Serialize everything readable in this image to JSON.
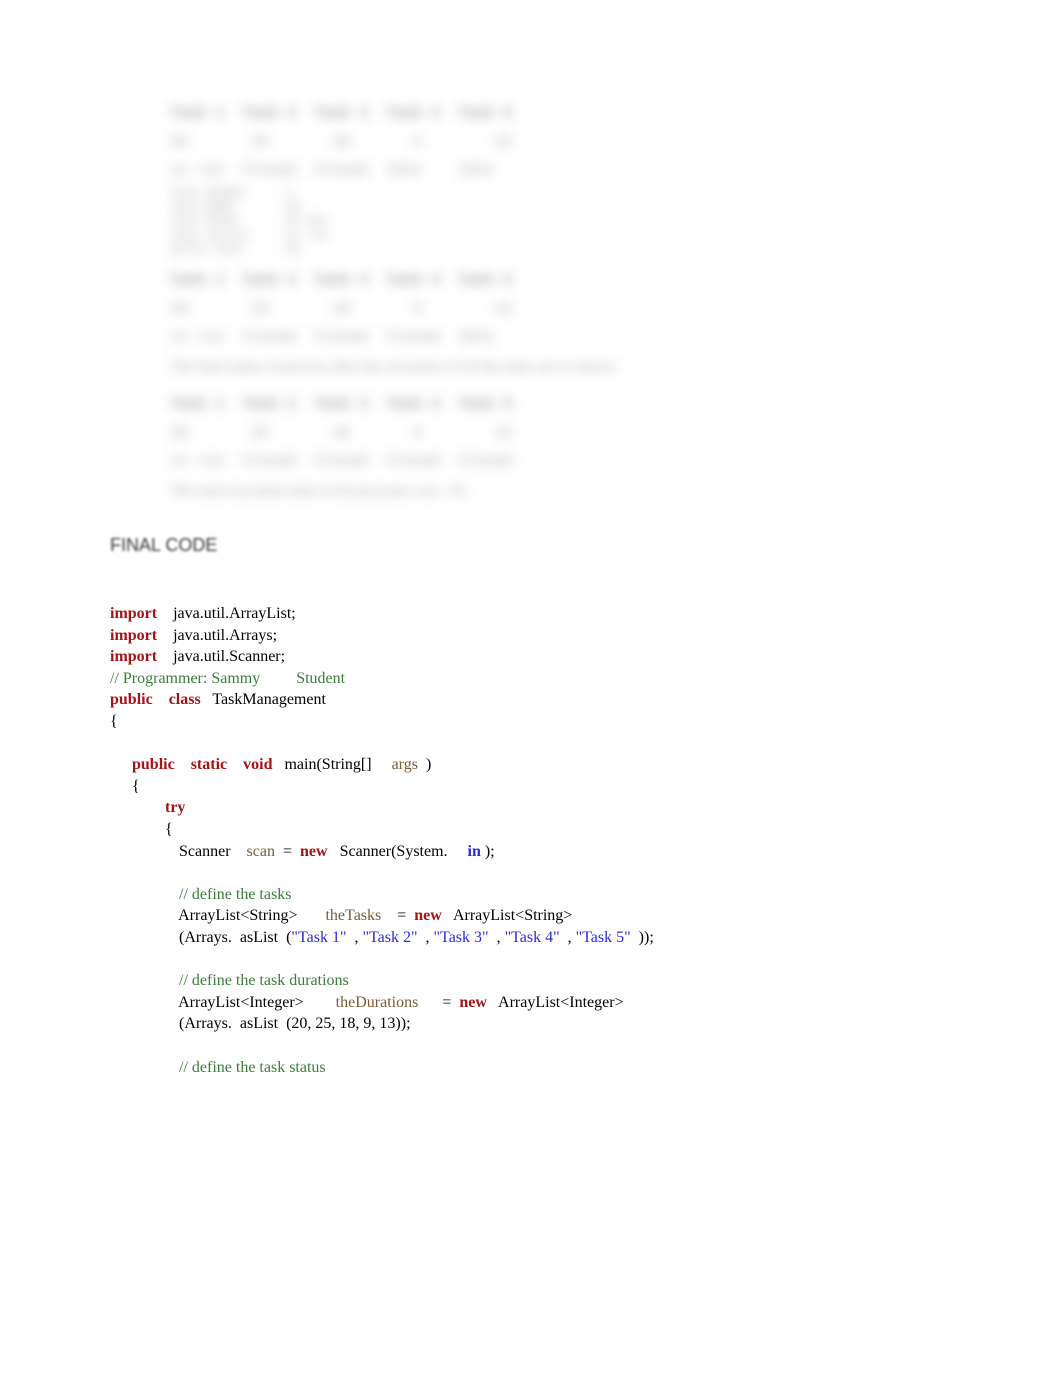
{
  "blurred": {
    "header_row": "Task 1  Task 2  Task 3  Task 4  Task 5",
    "values_row": "20       25       18       9        13",
    "status_row1": "in run  Closed  Closed  Idle    Idle",
    "meta_block": "Task Number   : 1\nTask Name     : 20\nTask Power    : 20 min\nTask Status   : in run\nDelta Task    : 20",
    "status_row2": "in run  Closed  Closed  Closed  Idle",
    "mid_text": "The final status of process after the execution of all the tasks are as shown",
    "status_row3": "in run  Closed  Closed  Closed  Closed",
    "total_text": "The total execution time of all processes was : 85"
  },
  "heading": "FINAL CODE",
  "code": {
    "import1_kw": "import",
    "import1_txt": "    java.util.ArrayList;",
    "import2_kw": "import",
    "import2_txt": "    java.util.Arrays;",
    "import3_kw": "import",
    "import3_txt": "    java.util.Scanner;",
    "comment_prog": "// Programmer: Sammy         Student",
    "public_kw": "public",
    "class_kw": "class",
    "class_name": "   TaskManagement",
    "brace_open": "{",
    "main_public": "public",
    "main_static": "static",
    "main_void": "void",
    "main_sig1": "   main(String[]     ",
    "main_args": "args",
    "main_sig2": "  )",
    "brace_open2": "{",
    "try_kw": "try",
    "brace_open3": "{",
    "scanner_txt1": " Scanner    ",
    "scanner_var": "scan",
    "scanner_eq": "  =  ",
    "new_kw": "new",
    "scanner_txt2": "   Scanner(System.     ",
    "in_kw": "in",
    "scanner_txt3": " );",
    "blank": "",
    "comment_tasks": " // define the tasks",
    "tasks_decl1": " ArrayList<String>       ",
    "tasks_var": "theTasks",
    "tasks_decl2": "    =  ",
    "tasks_new": "new",
    "tasks_decl3": "   ArrayList<String>",
    "tasks_arr1": " (Arrays.  asList  (",
    "task1": "\"Task 1\"",
    "comma": "  , ",
    "task2": "\"Task 2\"",
    "task3": "\"Task 3\"",
    "task4": "\"Task 4\"",
    "task5": "\"Task 5\"",
    "tasks_arr_end": "  ));",
    "comment_durations": " // define the task durations",
    "dur_decl1": " ArrayList<Integer>        ",
    "dur_var": "theDurations",
    "dur_decl2": "      =  ",
    "dur_new": "new",
    "dur_decl3": "   ArrayList<Integer>",
    "dur_arr": " (Arrays.  asList  (20, 25, 18, 9, 13));",
    "comment_status": " // define the task status"
  }
}
